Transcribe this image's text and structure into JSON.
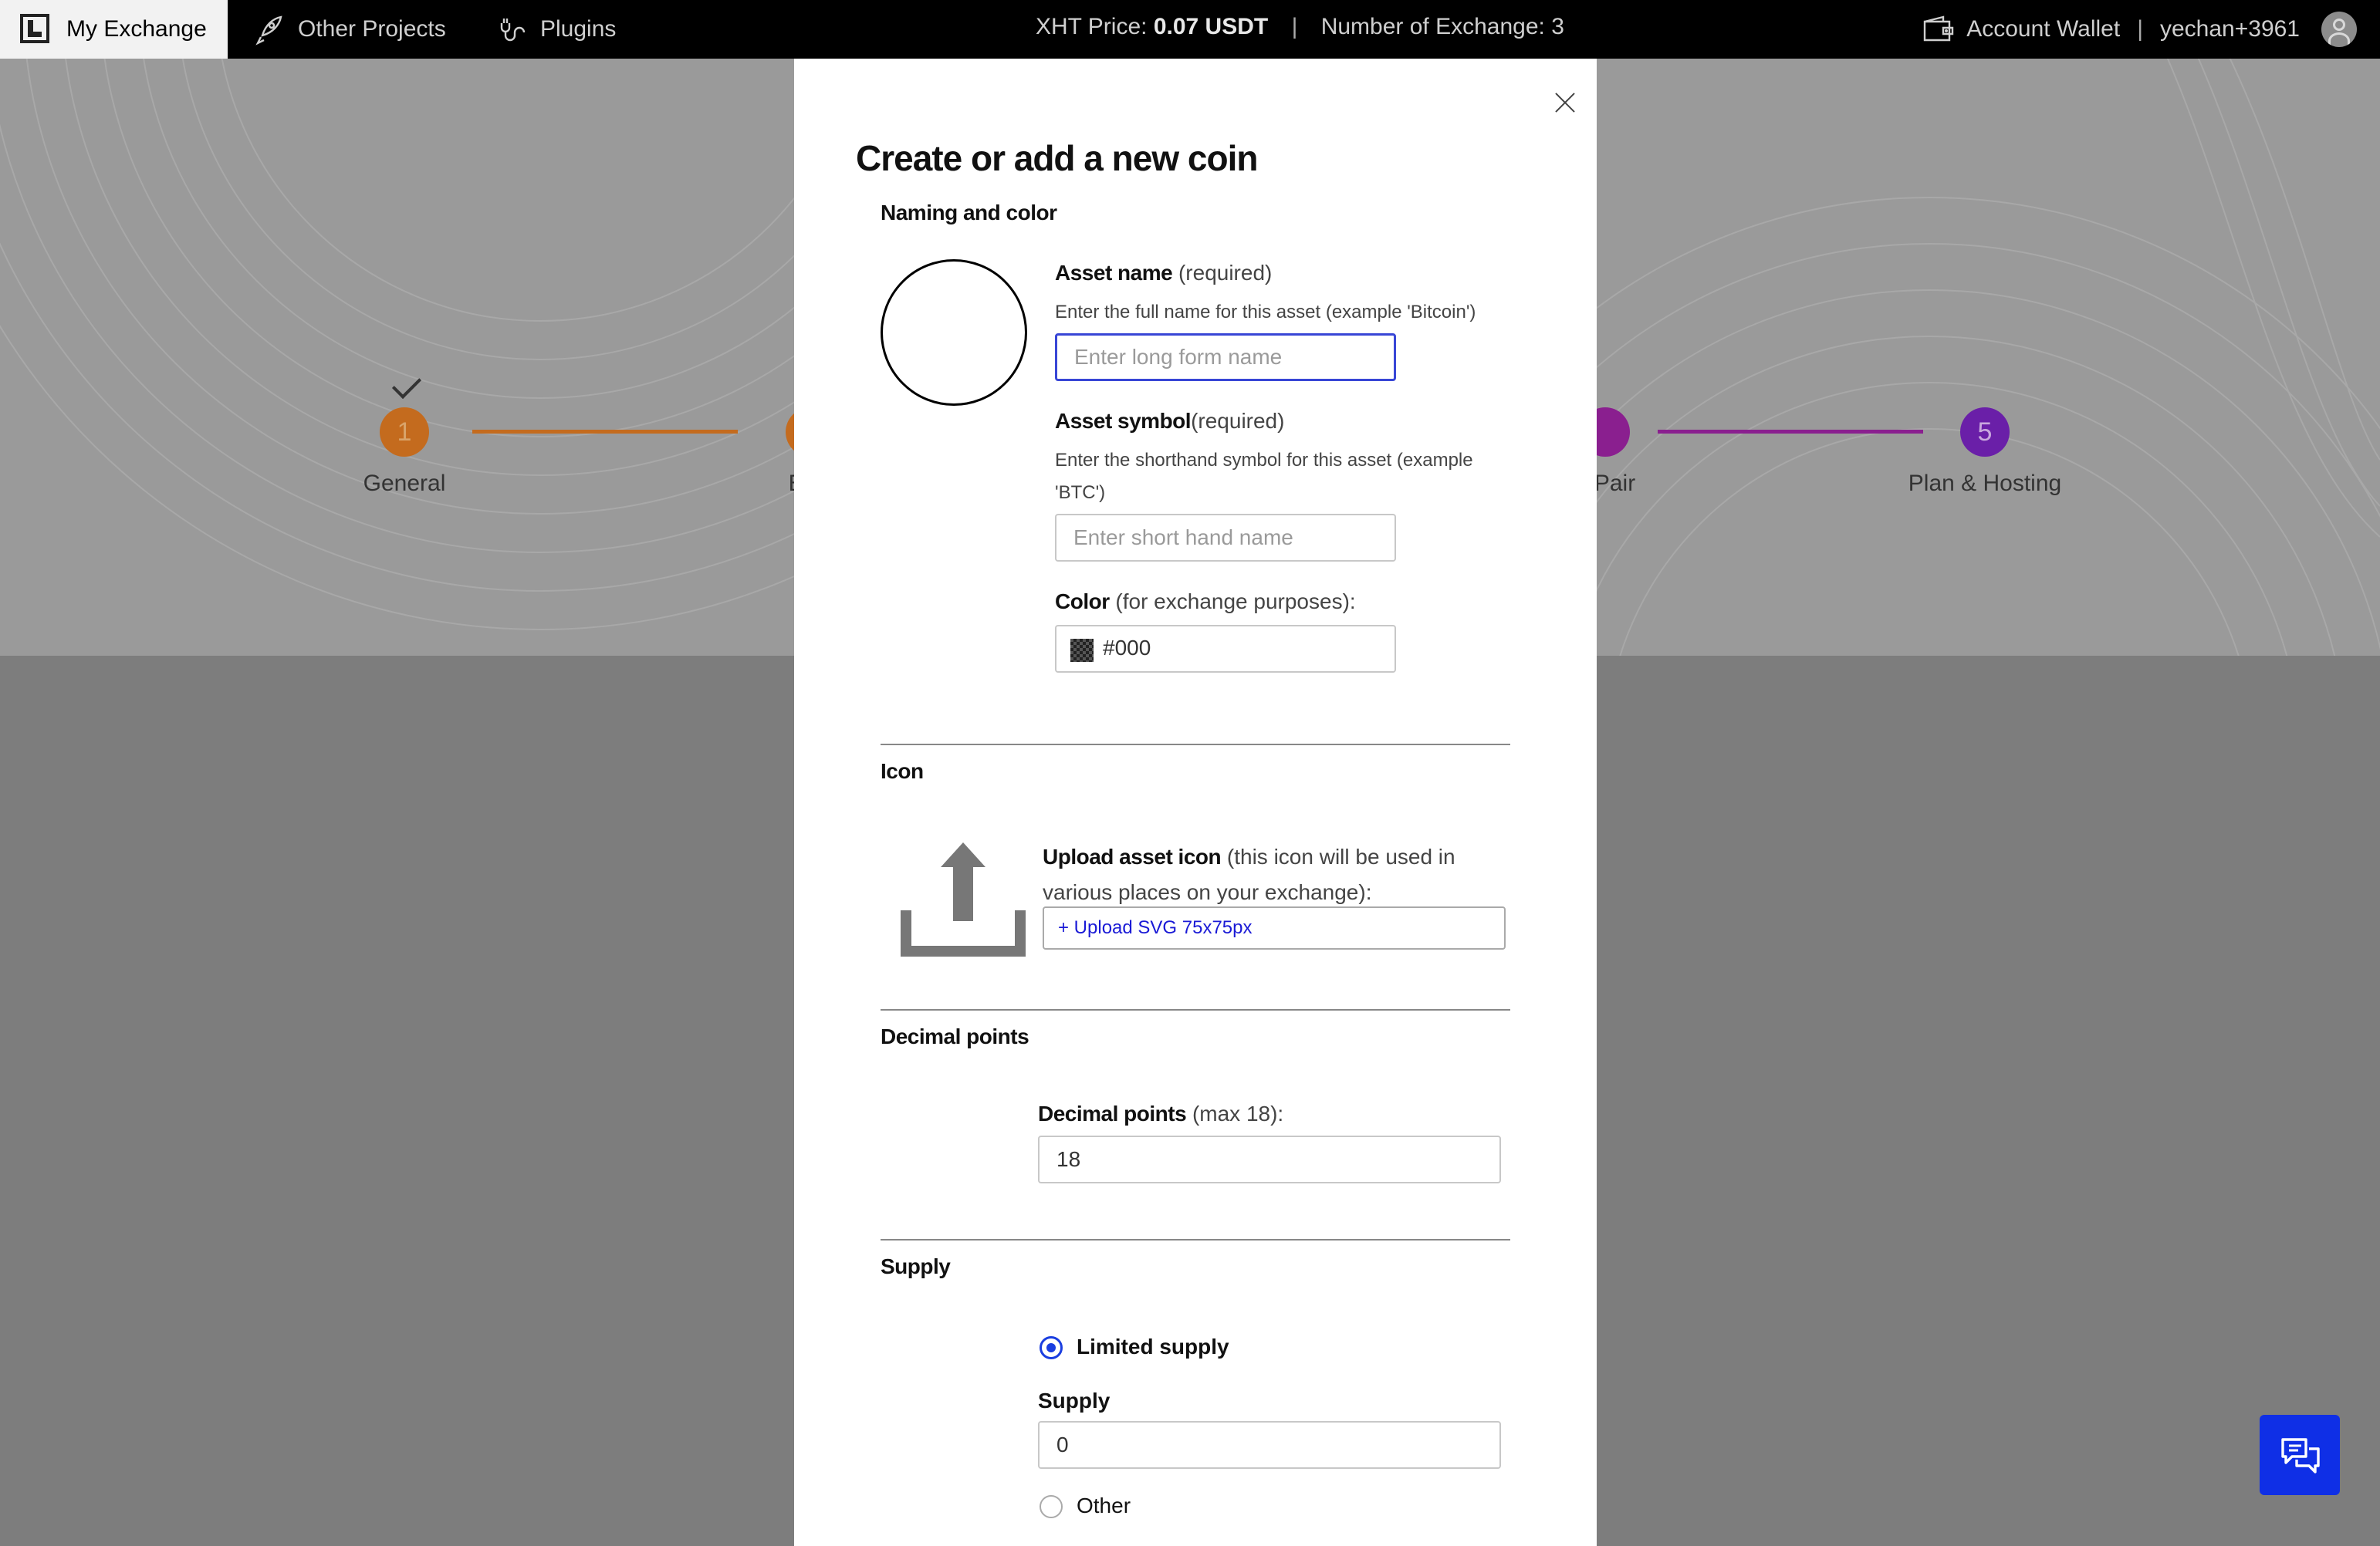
{
  "topbar": {
    "active_tab": "My Exchange",
    "nav": [
      "Other Projects",
      "Plugins"
    ],
    "price_label": "XHT Price:",
    "price_value": "0.07 USDT",
    "exchange_count": "Number of Exchange: 3",
    "wallet": "Account Wallet",
    "user": "yechan+3961"
  },
  "stepper": {
    "steps": [
      {
        "number": "1",
        "label": "General",
        "color": "#c46b1e"
      },
      {
        "number": "",
        "label": "Brar",
        "color": "#c46b1e"
      },
      {
        "number": "",
        "label": "g Pair",
        "color": "#8a1f8f"
      },
      {
        "number": "5",
        "label": "Plan & Hosting",
        "color": "#6a1fa8"
      }
    ]
  },
  "modal": {
    "title": "Create or add a new coin",
    "sections": {
      "naming": "Naming and color",
      "icon": "Icon",
      "decimal": "Decimal points",
      "supply": "Supply"
    },
    "asset_name": {
      "label": "Asset name",
      "note": "(required)",
      "help": "Enter the full name for this asset (example 'Bitcoin')",
      "placeholder": "Enter long form name",
      "value": ""
    },
    "asset_symbol": {
      "label": "Asset symbol",
      "note": "(required)",
      "help": "Enter the shorthand symbol for this asset (example 'BTC')",
      "placeholder": "Enter short hand name",
      "value": ""
    },
    "color": {
      "label": "Color",
      "note": "(for exchange purposes):",
      "value": "#000"
    },
    "upload": {
      "label": "Upload asset icon",
      "note": "(this icon will be used in various places on your exchange):",
      "button": "+ Upload SVG 75x75px"
    },
    "decimal_points": {
      "label": "Decimal points",
      "note": "(max 18):",
      "value": "18"
    },
    "supply": {
      "option_limited": "Limited supply",
      "label": "Supply",
      "value": "0",
      "option_other": "Other",
      "selected": "Limited supply"
    }
  },
  "colors": {
    "accent_blue": "#1a3ee0",
    "chat_button": "#0f2fe6"
  }
}
